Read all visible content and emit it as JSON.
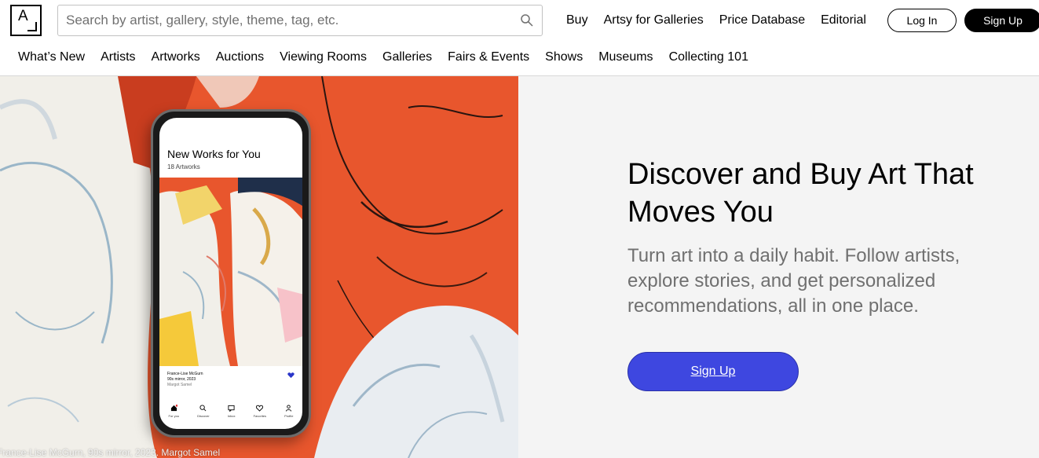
{
  "header": {
    "logo_letter": "A",
    "search_placeholder": "Search by artist, gallery, style, theme, tag, etc.",
    "search_icon": "search-icon",
    "links": [
      "Buy",
      "Artsy for Galleries",
      "Price Database",
      "Editorial"
    ],
    "login_label": "Log In",
    "signup_label": "Sign Up"
  },
  "subnav": [
    "What’s New",
    "Artists",
    "Artworks",
    "Auctions",
    "Viewing Rooms",
    "Galleries",
    "Fairs & Events",
    "Shows",
    "Museums",
    "Collecting 101"
  ],
  "hero": {
    "headline": "Discover and Buy Art That Moves You",
    "subhead": "Turn art into a daily habit. Follow artists, explore stories, and get personalized recommendations, all in one place.",
    "cta_label": "Sign Up",
    "image_caption": "France-Lise McGurn, 90s mirror, 2023. Margot Samel",
    "colors": {
      "accent": "#3e47e0",
      "art_orange": "#e8562d",
      "panel_bg": "#f4f4f4"
    }
  },
  "phone": {
    "title": "New Works for You",
    "count": "18 Artworks",
    "artist": "France-Lise McGurn",
    "artwork": "90s mirror, 2023",
    "gallery": "Margot Samel",
    "tabs": [
      {
        "label": "For you",
        "icon": "home-icon"
      },
      {
        "label": "Discover",
        "icon": "search-icon"
      },
      {
        "label": "Inbox",
        "icon": "chat-icon"
      },
      {
        "label": "Favorites",
        "icon": "heart-icon"
      },
      {
        "label": "Profile",
        "icon": "profile-icon"
      }
    ]
  }
}
